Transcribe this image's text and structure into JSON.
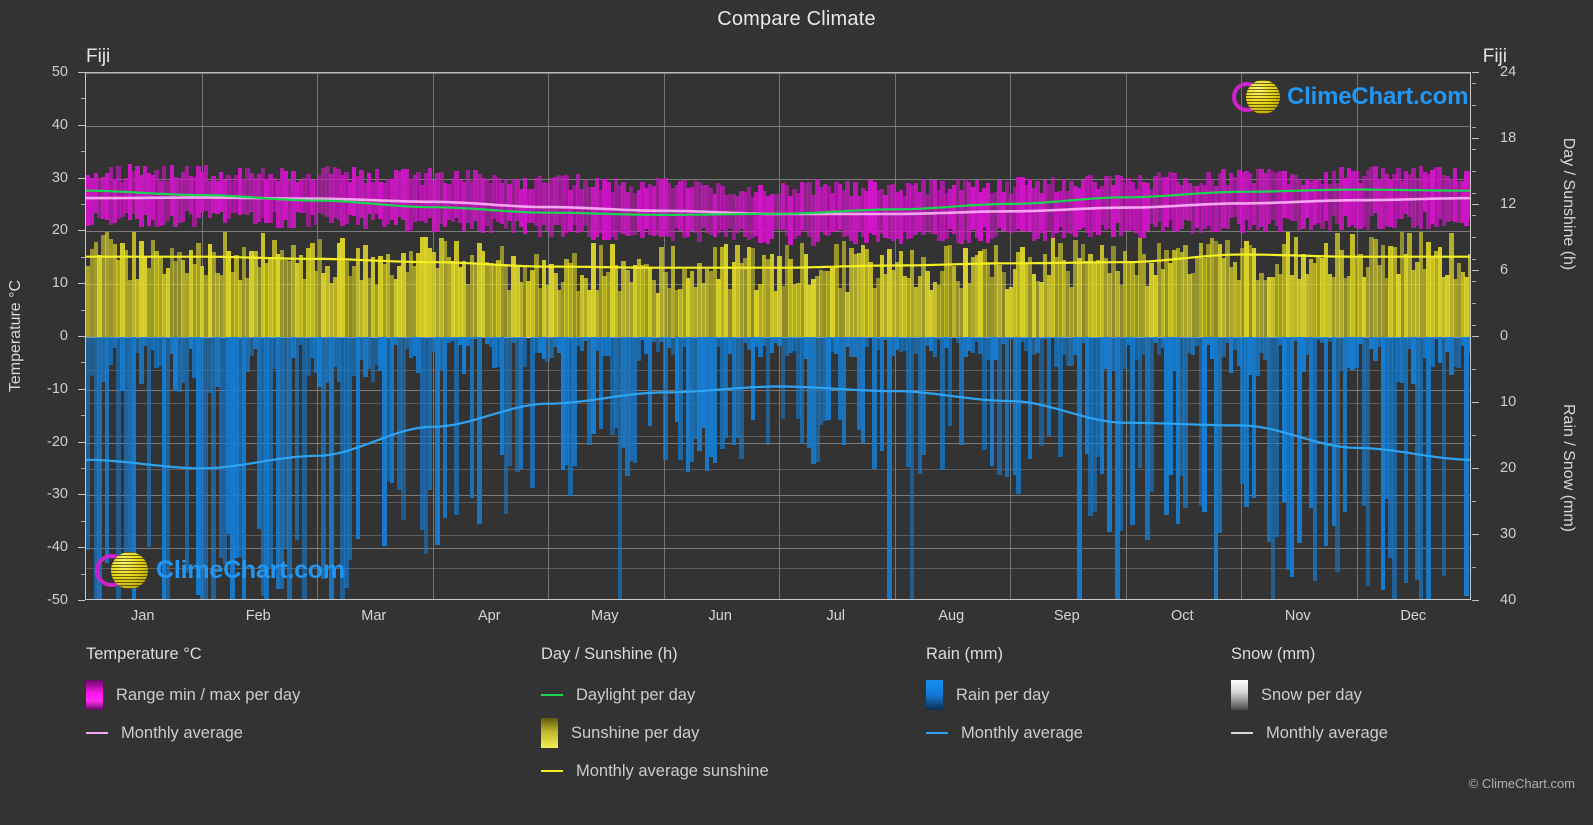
{
  "header": {
    "title": "Compare Climate",
    "location_left": "Fiji",
    "location_right": "Fiji"
  },
  "axes": {
    "left_label": "Temperature °C",
    "right_top_label": "Day / Sunshine (h)",
    "right_bottom_label": "Rain / Snow (mm)",
    "left_ticks": [
      "50",
      "40",
      "30",
      "20",
      "10",
      "0",
      "-10",
      "-20",
      "-30",
      "-40",
      "-50"
    ],
    "right_top_ticks": [
      "24",
      "18",
      "12",
      "6",
      "0"
    ],
    "right_bottom_ticks": [
      "0",
      "10",
      "20",
      "30",
      "40"
    ],
    "x_ticks": [
      "Jan",
      "Feb",
      "Mar",
      "Apr",
      "May",
      "Jun",
      "Jul",
      "Aug",
      "Sep",
      "Oct",
      "Nov",
      "Dec"
    ]
  },
  "legend": {
    "columns": [
      {
        "heading": "Temperature °C",
        "items": [
          {
            "label": "Range min / max per day",
            "marker": "swatch",
            "color": "#ff00e0"
          },
          {
            "label": "Monthly average",
            "marker": "line",
            "color": "#f6a6f0"
          }
        ]
      },
      {
        "heading": "Day / Sunshine (h)",
        "items": [
          {
            "label": "Daylight per day",
            "marker": "line",
            "color": "#17d74f"
          },
          {
            "label": "Sunshine per day",
            "marker": "swatch",
            "color": "#f2ec4a"
          },
          {
            "label": "Monthly average sunshine",
            "marker": "line",
            "color": "#f5f024"
          }
        ]
      },
      {
        "heading": "Rain (mm)",
        "items": [
          {
            "label": "Rain per day",
            "marker": "swatch",
            "color": "#1484e0"
          },
          {
            "label": "Monthly average",
            "marker": "line",
            "color": "#2ea3f2"
          }
        ]
      },
      {
        "heading": "Snow (mm)",
        "items": [
          {
            "label": "Snow per day",
            "marker": "swatch",
            "color": "#f0f0f0"
          },
          {
            "label": "Monthly average",
            "marker": "line",
            "color": "#d8d8d8"
          }
        ]
      }
    ]
  },
  "branding": {
    "wordmark": "ClimeChart.com",
    "copyright": "© ClimeChart.com",
    "logo_ring_color": "#cc22cc",
    "logo_globe_color": "#e8d317",
    "wordmark_color": "#2196f3"
  },
  "chart_data": {
    "type": "area",
    "title": "Compare Climate",
    "subtitle": "Fiji",
    "xlabel": "",
    "ylabel": "Temperature °C",
    "y2label_top": "Day / Sunshine (h)",
    "y2label_bottom": "Rain / Snow (mm)",
    "ylim": [
      -50,
      50
    ],
    "y2lim_top": [
      0,
      24
    ],
    "y2lim_bottom": [
      0,
      40
    ],
    "grid": true,
    "legend_position": "below",
    "categories": [
      "Jan",
      "Feb",
      "Mar",
      "Apr",
      "May",
      "Jun",
      "Jul",
      "Aug",
      "Sep",
      "Oct",
      "Nov",
      "Dec"
    ],
    "series": [
      {
        "name": "Temperature monthly average",
        "unit": "°C",
        "axis": "left",
        "color": "#f6a6f0",
        "values": [
          26.3,
          26.4,
          26.2,
          25.6,
          24.6,
          23.9,
          23.3,
          23.3,
          23.8,
          24.5,
          25.3,
          25.9
        ]
      },
      {
        "name": "Temperature range max per day",
        "unit": "°C",
        "axis": "left",
        "color": "#ff00e0",
        "values": [
          30.5,
          30.6,
          30.4,
          29.9,
          29.0,
          28.2,
          27.7,
          27.8,
          28.3,
          29.0,
          29.7,
          30.2
        ]
      },
      {
        "name": "Temperature range min per day",
        "unit": "°C",
        "axis": "left",
        "color": "#ff00e0",
        "values": [
          22.6,
          22.8,
          22.6,
          21.9,
          20.7,
          19.9,
          19.2,
          19.3,
          19.9,
          20.7,
          21.6,
          22.3
        ]
      },
      {
        "name": "Daylight per day",
        "unit": "h",
        "axis": "right_top",
        "color": "#17d74f",
        "values": [
          13.3,
          12.9,
          12.4,
          11.8,
          11.3,
          11.1,
          11.2,
          11.6,
          12.1,
          12.7,
          13.2,
          13.4
        ]
      },
      {
        "name": "Monthly average sunshine",
        "unit": "h",
        "axis": "right_top",
        "color": "#f5f024",
        "values": [
          7.3,
          7.3,
          7.1,
          6.8,
          6.4,
          6.3,
          6.3,
          6.5,
          6.7,
          6.8,
          7.5,
          7.3
        ]
      },
      {
        "name": "Rain monthly average",
        "unit": "mm",
        "axis": "right_bottom",
        "color": "#2ea3f2",
        "values": [
          18.6,
          19.9,
          18.0,
          13.6,
          10.1,
          8.4,
          7.5,
          8.2,
          9.7,
          13.0,
          13.4,
          16.8
        ]
      },
      {
        "name": "Snow monthly average",
        "unit": "mm",
        "axis": "right_bottom",
        "color": "#d8d8d8",
        "values": [
          0,
          0,
          0,
          0,
          0,
          0,
          0,
          0,
          0,
          0,
          0,
          0
        ]
      }
    ]
  }
}
